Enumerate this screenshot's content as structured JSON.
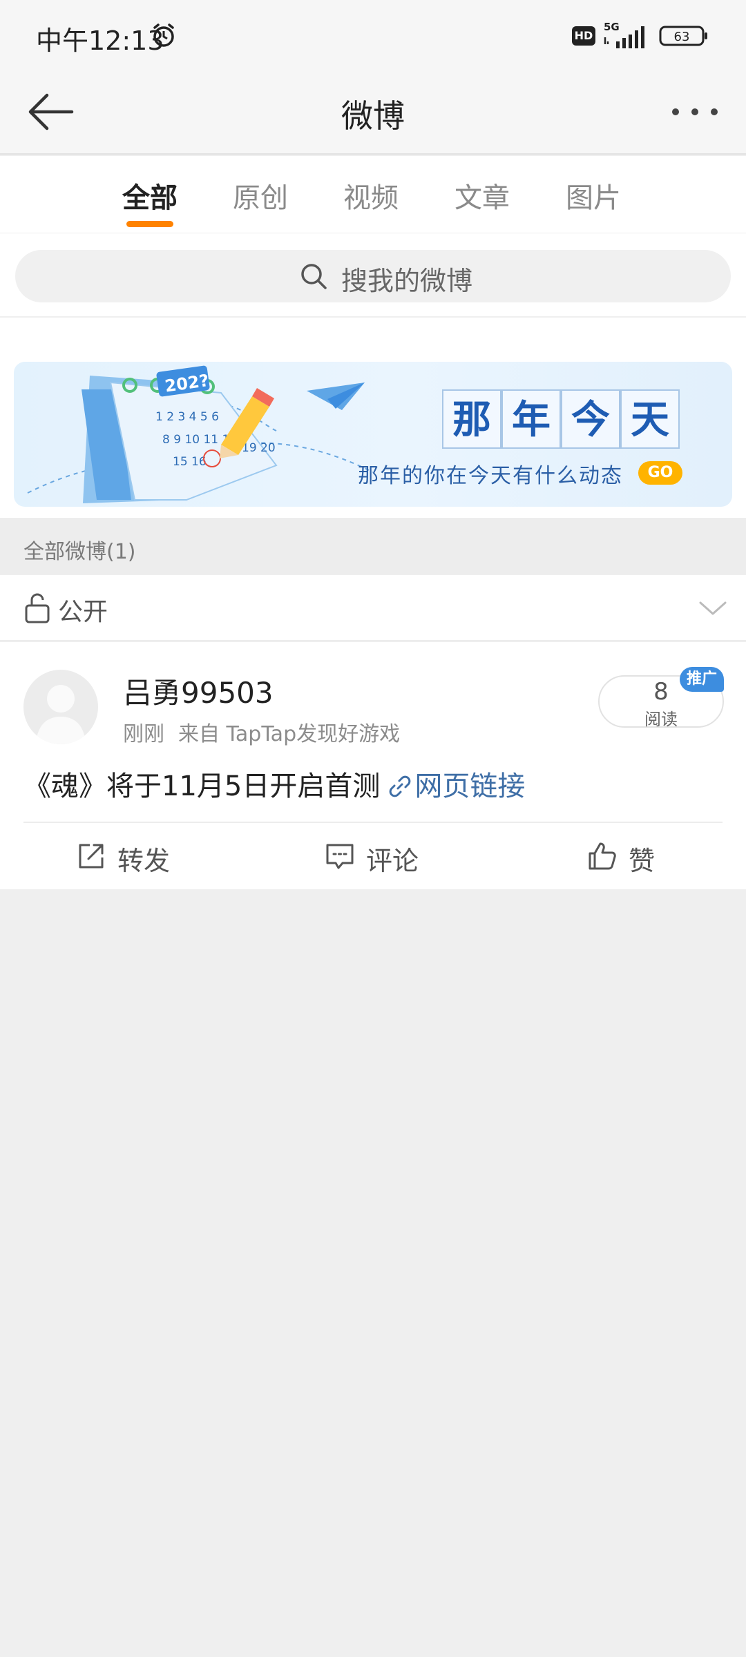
{
  "status_bar": {
    "time": "中午12:13",
    "hd": "HD",
    "network": "5G",
    "battery": "63"
  },
  "nav": {
    "title": "微博",
    "back_icon": "back-arrow-icon",
    "more_icon": "more-dots-icon"
  },
  "tabs": [
    {
      "label": "全部",
      "active": true
    },
    {
      "label": "原创",
      "active": false
    },
    {
      "label": "视频",
      "active": false
    },
    {
      "label": "文章",
      "active": false
    },
    {
      "label": "图片",
      "active": false
    }
  ],
  "accent_color": "#ff8200",
  "search": {
    "placeholder": "搜我的微博"
  },
  "banner": {
    "title_chars": [
      "那",
      "年",
      "今",
      "天"
    ],
    "subtitle": "那年的你在今天有什么动态",
    "go_label": "GO",
    "calendar_year": "202?"
  },
  "section": {
    "label": "全部微博(1)"
  },
  "privacy": {
    "label": "公开"
  },
  "post": {
    "username": "吕勇99503",
    "time": "刚刚",
    "source": "来自 TapTap发现好游戏",
    "read_count": "8",
    "read_label": "阅读",
    "promo_tag": "推广",
    "text": "《魂》将于11月5日开启首测",
    "link_text": "网页链接",
    "link_color": "#3e6ea6",
    "actions": {
      "repost": "转发",
      "comment": "评论",
      "like": "赞"
    }
  }
}
